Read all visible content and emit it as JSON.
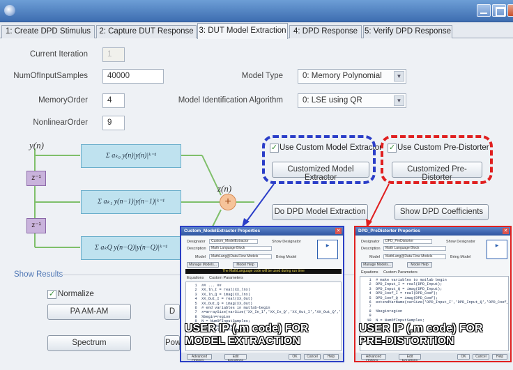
{
  "window": {
    "icon": "app-icon"
  },
  "tabs": [
    {
      "label": "1: Create DPD Stimulus"
    },
    {
      "label": "2: Capture DUT Response"
    },
    {
      "label": "3: DUT Model Extraction"
    },
    {
      "label": "4: DPD Response"
    },
    {
      "label": "5: Verify DPD Response"
    }
  ],
  "form": {
    "current_iteration_label": "Current Iteration",
    "current_iteration_value": "1",
    "num_samples_label": "NumOfInputSamples",
    "num_samples_value": "40000",
    "memory_order_label": "MemoryOrder",
    "memory_order_value": "4",
    "nonlinear_order_label": "NonlinearOrder",
    "nonlinear_order_value": "9",
    "model_type_label": "Model Type",
    "model_type_value": "0: Memory Polynomial",
    "algorithm_label": "Model Identification Algorithm",
    "algorithm_value": "0: LSE using QR"
  },
  "diagram": {
    "input": "y(n)",
    "output": "z(n)",
    "delay": "z⁻¹",
    "sum": "+",
    "term1": "Σ aₖ₀ y(n)|y(n)|ᵏ⁻¹",
    "term2": "Σ aₖ₁ y(n−1)|y(n−1)|ᵏ⁻¹",
    "term3": "Σ aₖQ y(n−Q)|y(n−Q)|ᵏ⁻¹"
  },
  "custom": {
    "extractor_check_label": "Use Custom Model Extractor",
    "extractor_button": "Customized Model Extractor",
    "predistorter_check_label": "Use Custom Pre-Distorter",
    "predistorter_button": "Customized Pre-Distorter",
    "extract_button": "Do DPD Model Extraction",
    "coeff_button": "Show DPD Coefficients"
  },
  "results": {
    "section_label": "Show Results",
    "normalize_label": "Normalize",
    "am_am_button": "PA AM-AM",
    "d_button": "D",
    "spectrum_button": "Spectrum",
    "pow_button": "Pow"
  },
  "popup_left": {
    "title": "Custom_ModelExtractor Properties",
    "designator_label": "Designator",
    "designator_value": "Custom_ModelExtractor",
    "description_label": "Description",
    "description_value": "Math Language Block",
    "model_label": "Model",
    "model_value": "MathLang@Data Flow Models",
    "show_designator": "Show Designator",
    "bring_model": "Bring Model",
    "manage_models": "Manage Models...",
    "model_help": "Model Help",
    "equations_tab": "Equations",
    "params_tab": "Custom Parameters",
    "bar_text": "The MathLanguage code will be used during run time",
    "code": "   1  ## ... ##\n   2  XX_ln_I = real(XX_lnx)\n   3  XX_ln_Q = imag(XX_lnx)\n   4  XX_Out_I = real(XX_Out)\n   5  XX_Out_Q = imag(XX_Out)\n   6  # end variables in matlab-begin\n   7  x=arraySize(varSize('XX_In_I','XX_In_Q','XX_Out_I','XX_Out_Q','Enable))\n   8  %begin=region\n   9  N = NumOfInputSamples;\n  10  M = MemoryOrder;\n  11  K = NonlinearOrder;",
    "overlay": "USER IP (.m code) FOR MODEL EXTRACTION",
    "advanced": "Advanced Options...",
    "edit_eq": "Edit Equations",
    "ok": "OK",
    "cancel": "Cancel",
    "help": "Help"
  },
  "popup_right": {
    "title": "DPD_PreDistorter Properties",
    "designator_label": "Designator",
    "designator_value": "DPD_PreDistorter",
    "description_label": "Description",
    "description_value": "Math Language Block",
    "model_label": "Model",
    "model_value": "MathLang@Data Flow Models",
    "show_designator": "Show Designator",
    "bring_model": "Bring Model",
    "manage_models": "Manage Models...",
    "model_help": "Model Help",
    "equations_tab": "Equations",
    "params_tab": "Custom Parameters",
    "code": "   1  # make variables to matlab begin\n   2  DPD_Input_I = real(DPD_Input);\n   3  DPD_Input_Q = imag(DPD_Input);\n   4  DPD_Coef_I = real(DPD_Coef);\n   5  DPD_Coef_Q = imag(DPD_Coef);\n   6  extendVarName(varSize('DPD_Input_I','DPD_Input_Q','DPD_Coef_I'))\n   7\n   8  %beginregion\n   9\n  10  N = NumOfInputSamples;",
    "overlay": "USER IP (.m code) FOR PRE-DISTORTION",
    "advanced": "Advanced Options...",
    "edit_eq": "Edit Equations",
    "ok": "OK",
    "cancel": "Cancel",
    "help": "Help"
  },
  "colors": {
    "highlight_blue": "#2b3ec8",
    "highlight_red": "#e02020"
  }
}
